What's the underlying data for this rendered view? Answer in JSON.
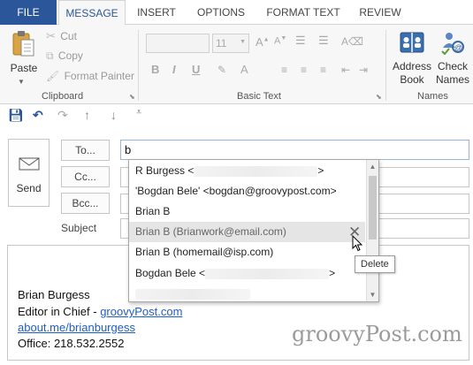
{
  "tabs": [
    "FILE",
    "MESSAGE",
    "INSERT",
    "OPTIONS",
    "FORMAT TEXT",
    "REVIEW"
  ],
  "ribbon": {
    "clipboard": {
      "paste": "Paste",
      "cut": "Cut",
      "copy": "Copy",
      "format_painter": "Format Painter",
      "group_label": "Clipboard"
    },
    "basic_text": {
      "font_size": "11",
      "bold": "B",
      "italic": "I",
      "underline": "U",
      "group_label": "Basic Text"
    },
    "names": {
      "address_book_line1": "Address",
      "address_book_line2": "Book",
      "check_names_line1": "Check",
      "check_names_line2": "Names",
      "group_label": "Names"
    }
  },
  "compose": {
    "send_label": "Send",
    "to_label": "To...",
    "cc_label": "Cc...",
    "bcc_label": "Bcc...",
    "subject_label": "Subject",
    "to_value": "b"
  },
  "autocomplete": {
    "items": [
      {
        "name": "R Burgess <",
        "suffix": ">"
      },
      {
        "name": "'Bogdan Bele' <bogdan@groovypost.com>"
      },
      {
        "name": "Brian B"
      },
      {
        "name": "Brian B (Brianwork@email.com)"
      },
      {
        "name": "Brian B (homemail@isp.com)"
      },
      {
        "name": "Bogdan Bele <",
        "suffix": ">"
      }
    ],
    "tooltip": "Delete"
  },
  "signature": {
    "name": "Brian Burgess",
    "title_prefix": "Editor in Chief - ",
    "title_link": "groovyPost.com",
    "profile_link": "about.me/brianburgess",
    "office": "Office: 218.532.2552"
  },
  "watermark": "groovyPost.com",
  "colors": {
    "accent": "#2b579a",
    "link": "#1f5fc2",
    "hover": "#e5e5e5"
  }
}
